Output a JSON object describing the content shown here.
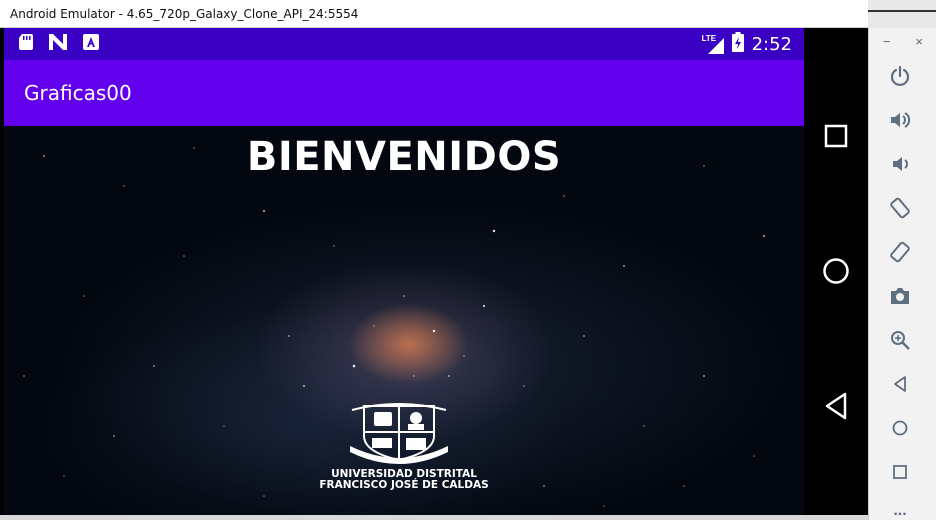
{
  "window": {
    "title": "Android Emulator - 4.65_720p_Galaxy_Clone_API_24:5554"
  },
  "status_bar": {
    "network_label": "LTE",
    "time": "2:52",
    "left_icons": [
      "sd-card-icon",
      "n-logo-icon",
      "a-notification-icon"
    ],
    "right_icons": [
      "lte-signal-icon",
      "battery-icon"
    ],
    "color": "#3a00c4"
  },
  "app_bar": {
    "title": "Graficas00",
    "color": "#6200ee"
  },
  "main": {
    "heading": "BIENVENIDOS",
    "university_line1": "UNIVERSIDAD DISTRITAL",
    "university_line2": "FRANCISCO JOSÉ DE CALDAS",
    "logo_icon": "university-crest-icon"
  },
  "nav": {
    "buttons": [
      "recents-square-icon",
      "home-circle-icon",
      "back-triangle-icon"
    ]
  },
  "side_toolbar": {
    "minimize": "−",
    "close": "×",
    "buttons": [
      "power-icon",
      "volume-up-icon",
      "volume-down-icon",
      "rotate-left-icon",
      "rotate-right-icon",
      "camera-icon",
      "zoom-icon",
      "back-icon",
      "home-icon",
      "overview-icon",
      "more-icon"
    ],
    "more_label": "..."
  }
}
